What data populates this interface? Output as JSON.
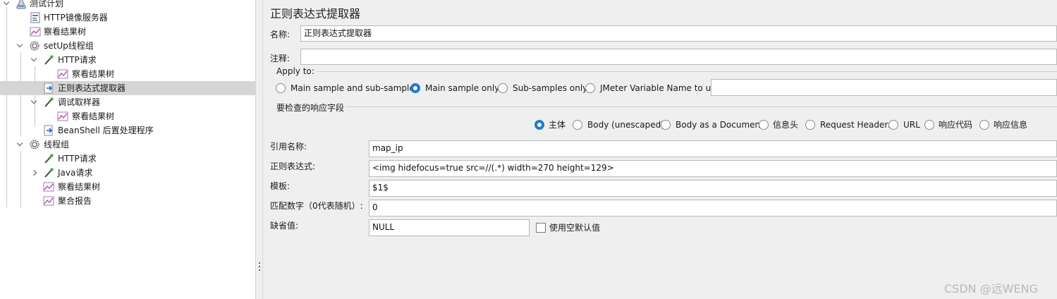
{
  "tree": {
    "items": [
      {
        "label": "测试计划",
        "icon": "test-plan-icon"
      },
      {
        "label": "HTTP镜像服务器",
        "icon": "mirror-server-icon"
      },
      {
        "label": "察看结果树",
        "icon": "view-results-tree-icon"
      },
      {
        "label": "setUp线程组",
        "icon": "setup-thread-group-icon"
      },
      {
        "label": "HTTP请求",
        "icon": "http-sampler-icon"
      },
      {
        "label": "察看结果树",
        "icon": "view-results-tree-icon"
      },
      {
        "label": "正则表达式提取器",
        "icon": "regex-extractor-icon"
      },
      {
        "label": "调试取样器",
        "icon": "debug-sampler-icon"
      },
      {
        "label": "察看结果树",
        "icon": "view-results-tree-icon"
      },
      {
        "label": "BeanShell 后置处理程序",
        "icon": "beanshell-postprocessor-icon"
      },
      {
        "label": "线程组",
        "icon": "thread-group-icon"
      },
      {
        "label": "HTTP请求",
        "icon": "http-sampler-icon"
      },
      {
        "label": "Java请求",
        "icon": "java-sampler-icon"
      },
      {
        "label": "察看结果树",
        "icon": "view-results-tree-icon"
      },
      {
        "label": "聚合报告",
        "icon": "aggregate-report-icon"
      }
    ]
  },
  "panel": {
    "title": "正则表达式提取器",
    "name_label": "名称:",
    "name_value": "正则表达式提取器",
    "comment_label": "注释:",
    "comment_value": "",
    "apply_to": {
      "legend": "Apply to:",
      "options": [
        "Main sample and sub-samples",
        "Main sample only",
        "Sub-samples only",
        "JMeter Variable Name to use"
      ],
      "selected": "Main sample only",
      "variable_value": ""
    },
    "response_field": {
      "legend": "要检查的响应字段",
      "options": [
        "主体",
        "Body (unescaped)",
        "Body as a Document",
        "信息头",
        "Request Headers",
        "URL",
        "响应代码",
        "响应信息"
      ],
      "selected": "主体"
    },
    "ref_name_label": "引用名称:",
    "ref_name_value": "map_ip",
    "regex_label": "正则表达式:",
    "regex_value": "<img hidefocus=true src=//(.*) width=270 height=129>",
    "template_label": "模板:",
    "template_value": "$1$",
    "match_no_label": "匹配数字（0代表随机）:",
    "match_no_value": "0",
    "default_label": "缺省值:",
    "default_value": "NULL",
    "use_empty_default_label": "使用空默认值",
    "use_empty_default_checked": false
  },
  "watermark": "CSDN @远WENG",
  "colors": {
    "selection": "#d5d5d5",
    "radio_selected": "#1f7ad1",
    "panel_bg": "#efefef"
  }
}
